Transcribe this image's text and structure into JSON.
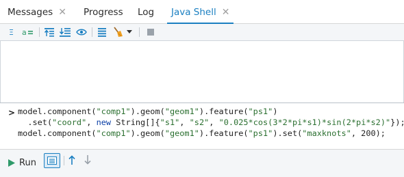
{
  "tabs": [
    {
      "label": "Messages",
      "closable": true
    },
    {
      "label": "Progress",
      "closable": false
    },
    {
      "label": "Log",
      "closable": false
    },
    {
      "label": "Java Shell",
      "closable": true,
      "active": true
    }
  ],
  "toolbar": {
    "icons": [
      "text-format-icon",
      "word-wrap-icon",
      "move-up-icon",
      "move-down-icon",
      "view-icon",
      "list-icon",
      "clear-broom-icon",
      "dropdown-arrow-icon",
      "stop-icon"
    ]
  },
  "editor": {
    "prompt": ">",
    "line1_a": "model.component(",
    "line1_s1": "\"comp1\"",
    "line1_b": ").geom(",
    "line1_s2": "\"geom1\"",
    "line1_c": ").feature(",
    "line1_s3": "\"ps1\"",
    "line1_d": ")",
    "line2_a": "  .set(",
    "line2_s1": "\"coord\"",
    "line2_b": ", ",
    "line2_kw": "new",
    "line2_c": " String[]{",
    "line2_s2": "\"s1\"",
    "line2_d": ", ",
    "line2_s3": "\"s2\"",
    "line2_e": ", ",
    "line2_s4": "\"0.025*cos(3*2*pi*s1)*sin(2*pi*s2)\"",
    "line2_f": "});",
    "line3_a": "model.component(",
    "line3_s1": "\"comp1\"",
    "line3_b": ").geom(",
    "line3_s2": "\"geom1\"",
    "line3_c": ").feature(",
    "line3_s3": "\"ps1\"",
    "line3_d": ").set(",
    "line3_s4": "\"maxknots\"",
    "line3_e": ", 200);"
  },
  "bottom": {
    "run_label": "Run"
  },
  "colors": {
    "accent": "#1a7fc1",
    "run_green": "#2f9a6a",
    "string": "#2a6f2f",
    "keyword": "#0b3fa6"
  }
}
